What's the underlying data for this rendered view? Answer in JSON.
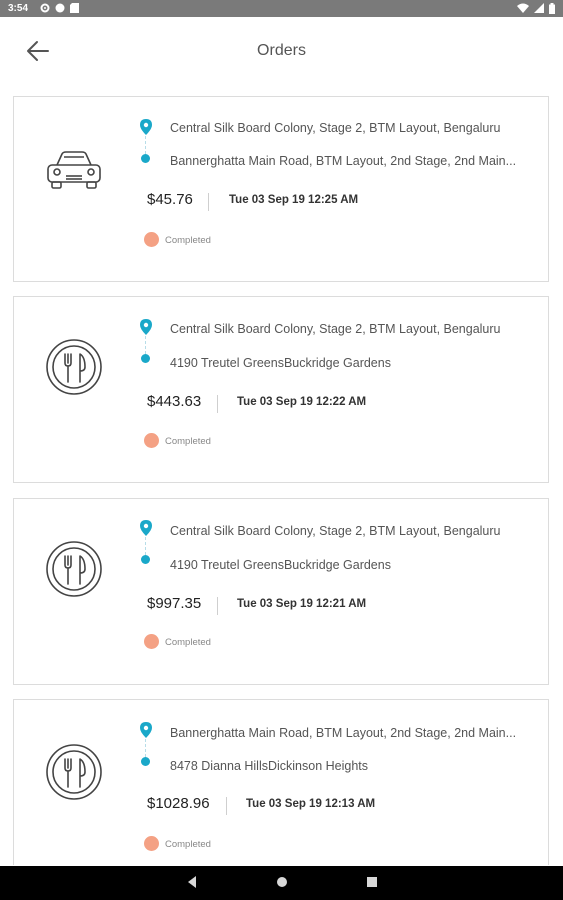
{
  "status_bar": {
    "time": "3:54",
    "left_icons": [
      "settings-icon",
      "circle-icon",
      "sd-card-icon"
    ],
    "right_icons": [
      "wifi-icon",
      "signal-icon",
      "battery-icon"
    ]
  },
  "header": {
    "title": "Orders",
    "back_icon": "arrow-left-icon"
  },
  "orders": [
    {
      "icon": "car-icon",
      "pickup": "Central Silk Board Colony, Stage 2, BTM Layout, Bengaluru",
      "drop": "Bannerghatta Main Road, BTM Layout, 2nd Stage, 2nd Main...",
      "price": "$45.76",
      "date": "Tue 03 Sep 19 12:25 AM",
      "status": "Completed"
    },
    {
      "icon": "restaurant-icon",
      "pickup": "Central Silk Board Colony, Stage 2, BTM Layout, Bengaluru",
      "drop": "4190 Treutel GreensBuckridge Gardens",
      "price": "$443.63",
      "date": "Tue 03 Sep 19 12:22 AM",
      "status": "Completed"
    },
    {
      "icon": "restaurant-icon",
      "pickup": "Central Silk Board Colony, Stage 2, BTM Layout, Bengaluru",
      "drop": "4190 Treutel GreensBuckridge Gardens",
      "price": "$997.35",
      "date": "Tue 03 Sep 19 12:21 AM",
      "status": "Completed"
    },
    {
      "icon": "restaurant-icon",
      "pickup": "Bannerghatta Main Road, BTM Layout, 2nd Stage, 2nd Main...",
      "drop": "8478 Dianna HillsDickinson Heights",
      "price": "$1028.96",
      "date": "Tue 03 Sep 19 12:13 AM",
      "status": "Completed"
    }
  ],
  "colors": {
    "accent": "#1aa8c9",
    "status_completed": "#f4a184",
    "status_bar": "#7a7a7a",
    "nav_bar": "#000000"
  },
  "nav": {
    "icons": [
      "back-triangle-icon",
      "home-circle-icon",
      "recents-square-icon"
    ]
  }
}
